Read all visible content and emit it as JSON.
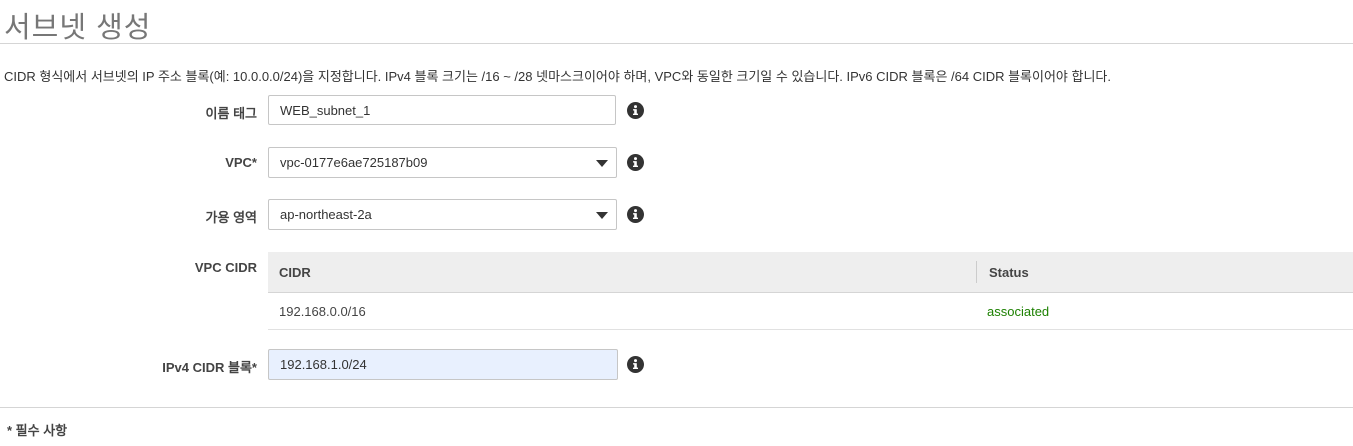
{
  "header": {
    "title": "서브넷 생성"
  },
  "description": "CIDR 형식에서 서브넷의 IP 주소 블록(예: 10.0.0.0/24)을 지정합니다. IPv4 블록 크기는 /16 ~ /28 넷마스크이어야 하며, VPC와 동일한 크기일 수 있습니다. IPv6 CIDR 블록은 /64 CIDR 블록이어야 합니다.",
  "form": {
    "name_tag": {
      "label": "이름 태그",
      "value": "WEB_subnet_1"
    },
    "vpc": {
      "label": "VPC*",
      "selected": "vpc-0177e6ae725187b09"
    },
    "availability_zone": {
      "label": "가용 영역",
      "selected": "ap-northeast-2a"
    },
    "vpc_cidr": {
      "label": "VPC CIDR",
      "columns": [
        "CIDR",
        "Status"
      ],
      "rows": [
        {
          "cidr": "192.168.0.0/16",
          "status": "associated"
        }
      ]
    },
    "ipv4_cidr": {
      "label": "IPv4 CIDR 블록*",
      "value": "192.168.1.0/24"
    }
  },
  "footer": {
    "required_note": "* 필수 사항"
  },
  "icons": {
    "info": "info-icon",
    "dropdown": "chevron-down-icon"
  },
  "colors": {
    "status_associated": "#1d8102",
    "info_icon": "#333333",
    "autofill_bg": "#e8f0fe"
  }
}
